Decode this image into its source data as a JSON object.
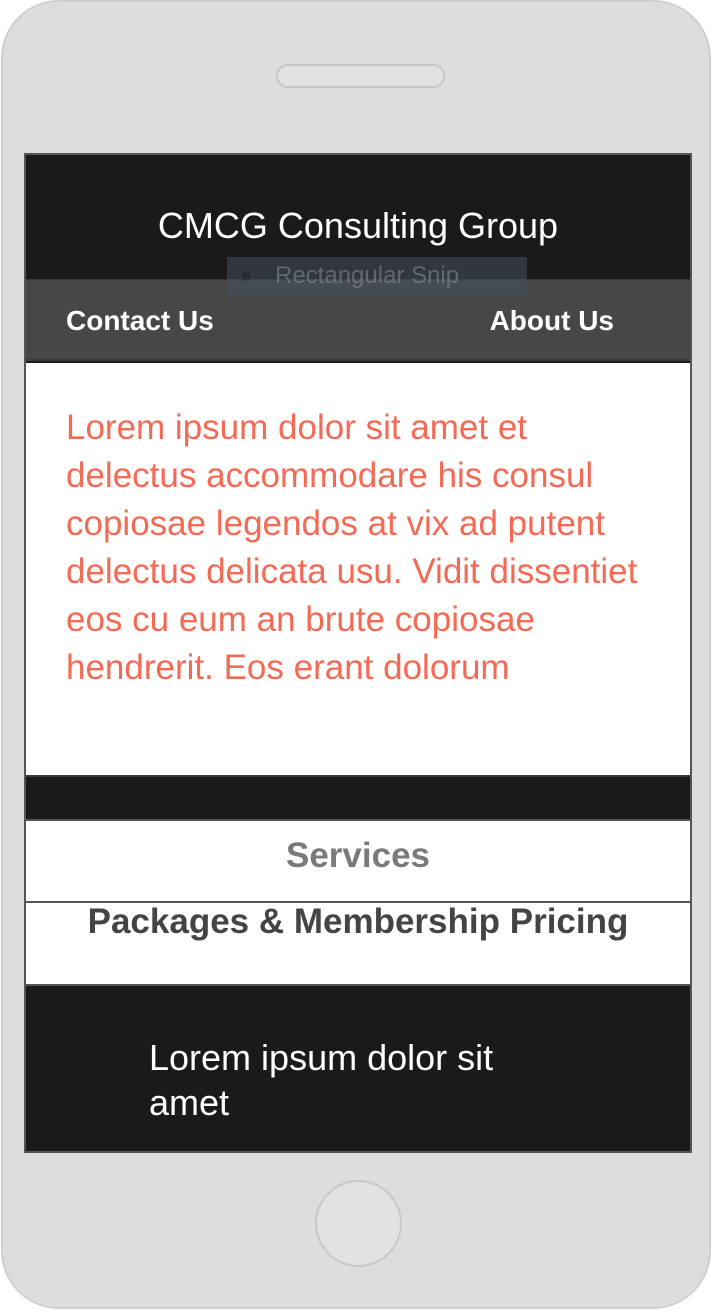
{
  "header": {
    "title": "CMCG Consulting Group"
  },
  "nav": {
    "contact_label": "Contact Us",
    "about_label": "About Us"
  },
  "overlay": {
    "label": "Rectangular Snip"
  },
  "main": {
    "body_text": "Lorem ipsum dolor sit amet et delectus accommodare his consul copiosae legendos at vix ad putent delectus delicata usu. Vidit dissentiet eos cu eum an brute copiosae hendrerit. Eos erant dolorum"
  },
  "buttons": {
    "services_label": "Services",
    "packages_label": "Packages & Membership Pricing"
  },
  "footer": {
    "text": "Lorem ipsum dolor sit amet"
  },
  "colors": {
    "dark": "#1a1a1a",
    "nav": "#474747",
    "accent_text": "#f46a55",
    "device": "#dddddd"
  }
}
